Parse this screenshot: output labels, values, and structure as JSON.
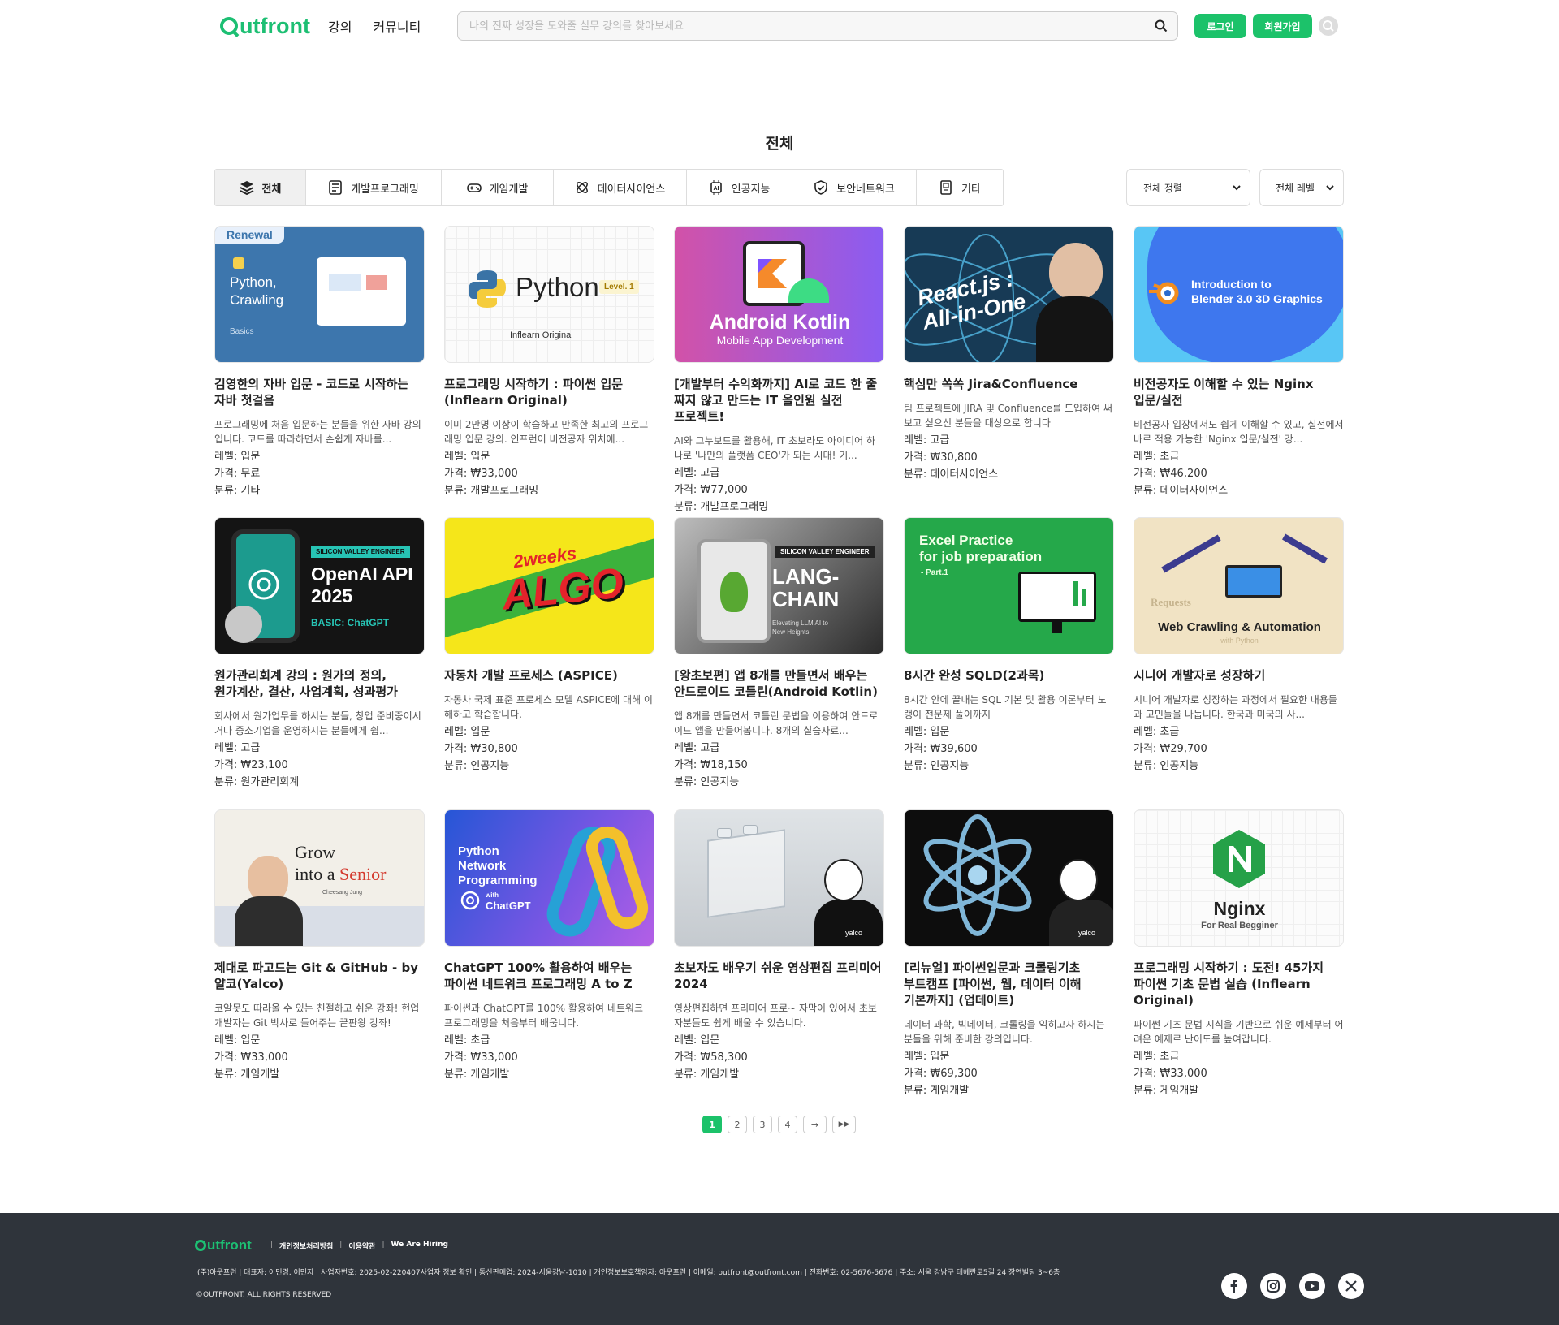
{
  "header": {
    "logo": "utfront",
    "nav": [
      "강의",
      "커뮤니티"
    ],
    "search_placeholder": "나의 진짜 성장을 도와줄 실무 강의를 찾아보세요",
    "login": "로그인",
    "signup": "회원가입"
  },
  "page": {
    "title": "전체"
  },
  "categories": [
    {
      "label": "전체",
      "icon": "layers-icon"
    },
    {
      "label": "개발프로그래밍",
      "icon": "monitor-code-icon"
    },
    {
      "label": "게임개발",
      "icon": "gamepad-icon"
    },
    {
      "label": "데이터사이언스",
      "icon": "molecule-icon"
    },
    {
      "label": "인공지능",
      "icon": "ai-chip-icon"
    },
    {
      "label": "보안네트워크",
      "icon": "shield-check-icon"
    },
    {
      "label": "기타",
      "icon": "book-icon"
    }
  ],
  "filters": {
    "sort": "전체 정렬",
    "level": "전체 레벨"
  },
  "courses": [
    {
      "title": "김영한의 자바 입문 - 코드로 시작하는 자바 첫걸음",
      "desc": "프로그래밍에 처음 입문하는 분들을 위한 자바 강의입니다. 코드를 따라하면서 손쉽게 자바를...",
      "level": "레벨: 입문",
      "price": "가격: 무료",
      "category": "분류: 기타",
      "thumb": {
        "badge": "Renewal",
        "lines": [
          "Python,",
          "Crawling"
        ],
        "sub": "Basics"
      }
    },
    {
      "title": "프로그래밍 시작하기 : 파이썬 입문 (Inflearn Original)",
      "desc": "이미 2만명 이상이 학습하고 만족한 최고의 프로그래밍 입문 강의. 인프런이 비전공자 위치에...",
      "level": "레벨: 입문",
      "price": "가격: ₩33,000",
      "category": "분류: 개발프로그래밍",
      "thumb": {
        "main": "Python",
        "tag": "Level. 1",
        "sub": "Inflearn Original"
      }
    },
    {
      "title": "[개발부터 수익화까지] AI로 코드 한 줄 짜지 않고 만드는 IT 올인원 실전 프로젝트!",
      "desc": "AI와 그누보드를 활용해, IT 초보라도 아이디어 하나로 '나만의 플랫폼 CEO'가 되는 시대! 기...",
      "level": "레벨: 고급",
      "price": "가격: ₩77,000",
      "category": "분류: 개발프로그래밍",
      "thumb": {
        "main": "Android Kotlin",
        "sub": "Mobile App Development"
      }
    },
    {
      "title": "핵심만 쏙쏙 Jira&Confluence",
      "desc": "팀 프로젝트에 JIRA 및 Confluence를 도입하여 써보고 싶으신 분들을 대상으로 합니다",
      "level": "레벨: 고급",
      "price": "가격: ₩30,800",
      "category": "분류: 데이터사이언스",
      "thumb": {
        "lines": [
          "React.js :",
          "All-in-One"
        ]
      }
    },
    {
      "title": "비전공자도 이해할 수 있는 Nginx 입문/실전",
      "desc": "비전공자 입장에서도 쉽게 이해할 수 있고, 실전에서 바로 적용 가능한 'Nginx 입문/실전' 강...",
      "level": "레벨: 초급",
      "price": "가격: ₩46,200",
      "category": "분류: 데이터사이언스",
      "thumb": {
        "lines": [
          "Introduction to",
          "Blender 3.0 3D Graphics"
        ]
      }
    },
    {
      "title": "원가관리회계 강의 : 원가의 정의, 원가계산, 결산, 사업계획, 성과평가",
      "desc": "회사에서 원가업무를 하시는 분들, 창업 준비중이시거나 중소기업을 운영하시는 분들에게 쉽...",
      "level": "레벨: 고급",
      "price": "가격: ₩23,100",
      "category": "분류: 원가관리회계",
      "thumb": {
        "tag": "SILICON VALLEY ENGINEER",
        "lines": [
          "OpenAI API",
          "2025"
        ],
        "sub": "BASIC: ChatGPT"
      }
    },
    {
      "title": "자동차 개발 프로세스 (ASPICE)",
      "desc": "자동차 국제 표준 프로세스 모델 ASPICE에 대해 이해하고 학습합니다.",
      "level": "레벨: 입문",
      "price": "가격: ₩30,800",
      "category": "분류: 인공지능",
      "thumb": {
        "small": "2weeks",
        "main": "ALGO"
      }
    },
    {
      "title": "[왕초보편] 앱 8개를 만들면서 배우는 안드로이드 코틀린(Android Kotlin)",
      "desc": "앱 8개를 만들면서 코틀린 문법을 이용하여 안드로이드 앱을 만들어봅니다. 8개의 실습자료...",
      "level": "레벨: 고급",
      "price": "가격: ₩18,150",
      "category": "분류: 인공지능",
      "thumb": {
        "tag": "SILICON VALLEY ENGINEER",
        "lines": [
          "LANG-",
          "CHAIN"
        ],
        "sub": "Elevating LLM AI to New Heights"
      }
    },
    {
      "title": "8시간 완성 SQLD(2과목)",
      "desc": "8시간 안에 끝내는 SQL 기본 및 활용 이론부터 노랭이 전문제 풀이까지",
      "level": "레벨: 입문",
      "price": "가격: ₩39,600",
      "category": "분류: 인공지능",
      "thumb": {
        "lines": [
          "Excel Practice",
          "for job preparation"
        ],
        "sub": "- Part.1"
      }
    },
    {
      "title": "시니어 개발자로 성장하기",
      "desc": "시니어 개발자로 성장하는 과정에서 필요한 내용들과 고민들을 나눕니다. 한국과 미국의 사...",
      "level": "레벨: 초급",
      "price": "가격: ₩29,700",
      "category": "분류: 인공지능",
      "thumb": {
        "main": "Web Crawling & Automation",
        "sub": "with Python",
        "small": "Requests"
      }
    },
    {
      "title": "제대로 파고드는 Git & GitHub - by 얄코(Yalco)",
      "desc": "코알못도 따라올 수 있는 친절하고 쉬운 강좌! 현업 개발자는 Git 박사로 들어주는 끝판왕 강좌!",
      "level": "레벨: 입문",
      "price": "가격: ₩33,000",
      "category": "분류: 게임개발",
      "thumb": {
        "lines": [
          "Grow",
          "into a"
        ],
        "main": "Senior",
        "sub": "Cheesang Jung"
      }
    },
    {
      "title": "ChatGPT 100% 활용하여 배우는 파이썬 네트워크 프로그래밍 A to Z",
      "desc": "파이썬과 ChatGPT를 100% 활용하여 네트워크 프로그래밍을 처음부터 배웁니다.",
      "level": "레벨: 초급",
      "price": "가격: ₩33,000",
      "category": "분류: 게임개발",
      "thumb": {
        "lines": [
          "Python",
          "Network",
          "Programming"
        ],
        "small": "with",
        "main": "ChatGPT"
      }
    },
    {
      "title": "초보자도 배우기 쉬운 영상편집 프리미어 2024",
      "desc": "영상편집하면 프리미어 프로~ 자막이 있어서 초보자분들도 쉽게 배울 수 있습니다.",
      "level": "레벨: 입문",
      "price": "가격: ₩58,300",
      "category": "분류: 게임개발",
      "thumb": {
        "sub": "yalco"
      }
    },
    {
      "title": "[리뉴얼] 파이썬입문과 크롤링기초 부트캠프 [파이썬, 웹, 데이터 이해 기본까지] (업데이트)",
      "desc": "데이터 과학, 빅데이터, 크롤링을 익히고자 하시는 분들을 위해 준비한 강의입니다.",
      "level": "레벨: 입문",
      "price": "가격: ₩69,300",
      "category": "분류: 게임개발",
      "thumb": {
        "sub": "yalco"
      }
    },
    {
      "title": "프로그래밍 시작하기 : 도전! 45가지 파이썬 기초 문법 실습 (Inflearn Original)",
      "desc": "파이썬 기초 문법 지식을 기반으로 쉬운 예제부터 어려운 예제로 난이도를 높여갑니다.",
      "level": "레벨: 초급",
      "price": "가격: ₩33,000",
      "category": "분류: 게임개발",
      "thumb": {
        "main": "Nginx",
        "sub": "For Real Begginer"
      }
    }
  ],
  "pagination": {
    "pages": [
      "1",
      "2",
      "3",
      "4"
    ],
    "next": "→",
    "last": "▶▶"
  },
  "footer": {
    "logo": "utfront",
    "links": [
      "개인정보처리방침",
      "이용약관",
      "We Are Hiring"
    ],
    "info": "(주)아웃프런 | 대표자: 이민경, 이민지 | 사업자번호: 2025-02-220407사업자 정보 확인 | 통신판매업: 2024-서울강남-1010 | 개인정보보호책임자: 아웃프런 | 이메일: outfront@outfront.com | 전화번호: 02-5676-5676 | 주소: 서울 강남구 테헤란로5길 24 장연빌딩 3~6층",
    "copyright": "©OUTFRONT. ALL RIGHTS RESERVED",
    "social": [
      "facebook-icon",
      "instagram-icon",
      "youtube-icon",
      "x-icon"
    ]
  }
}
